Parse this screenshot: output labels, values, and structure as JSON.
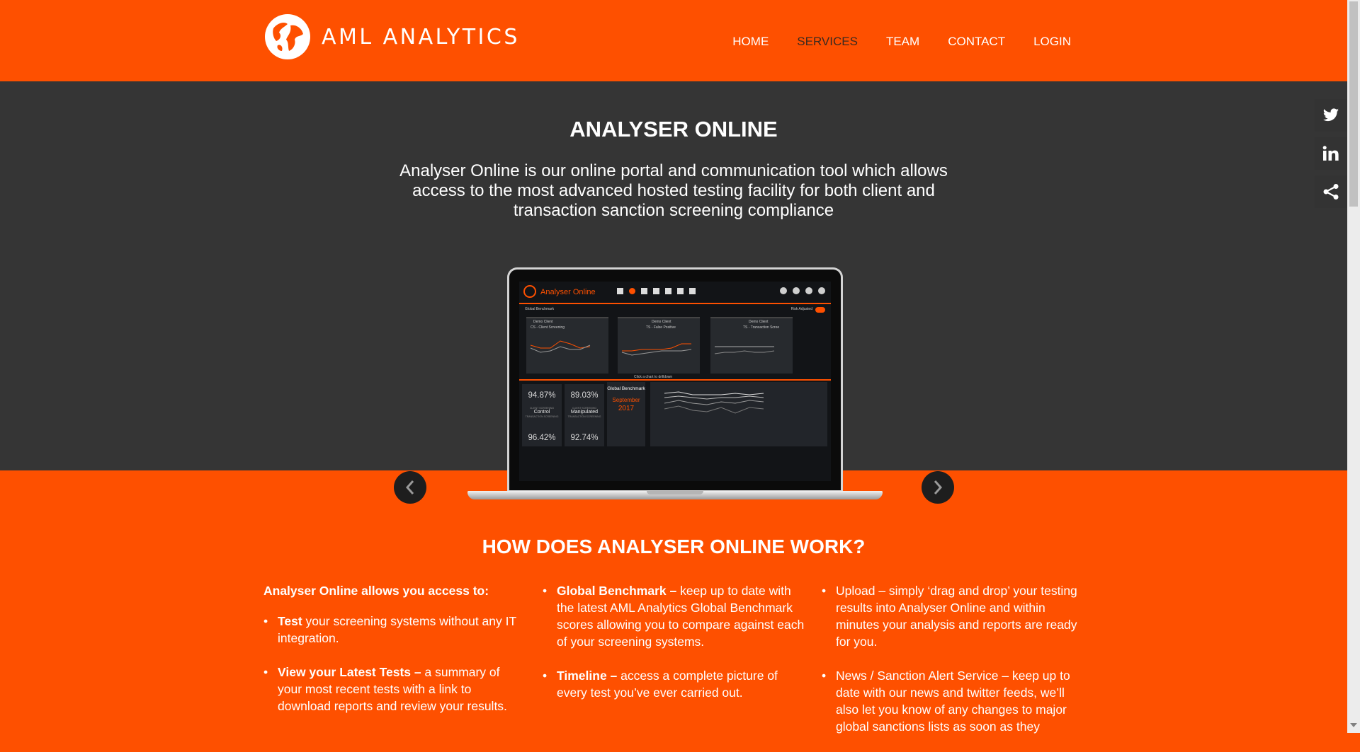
{
  "brand": {
    "name": "AML ANALYTICS",
    "accent": "#fe5000",
    "dark_band": "#353535"
  },
  "nav": {
    "items": [
      {
        "label": "HOME",
        "active": false
      },
      {
        "label": "SERVICES",
        "active": true
      },
      {
        "label": "TEAM",
        "active": false
      },
      {
        "label": "CONTACT",
        "active": false
      },
      {
        "label": "LOGIN",
        "active": false
      }
    ]
  },
  "hero": {
    "title": "ANALYSER ONLINE",
    "description": "Analyser Online is our online portal and communication tool which allows access to the most advanced hosted testing facility for both client and transaction sanction screening compliance",
    "prev_icon": "chevron-left-icon",
    "next_icon": "chevron-right-icon"
  },
  "dashboard": {
    "app_title": "Analyser Online",
    "global_benchmark_label": "Global Benchmark",
    "risk_adjusted_label": "Risk Adjusted",
    "click_chart_label": "Click a chart to drilldown",
    "chart_titles": [
      "Demo Client",
      "Demo Client",
      "Demo Client"
    ],
    "chart_subtitles": [
      "CS - Client Screening",
      "TS - False Positive",
      "TS - Transaction Scree"
    ],
    "stats": [
      {
        "pct": "94.87%",
        "tag": "CLIENT SCREENING",
        "label": "Control",
        "sub": "TRANSACTION SCREENING",
        "pct2": "96.42%"
      },
      {
        "pct": "89.03%",
        "tag": "CLIENT SCREENING",
        "label": "Manipulated",
        "sub": "TRANSACTION SCREENING",
        "pct2": "92.74%"
      }
    ],
    "benchmark": {
      "title": "Global Benchmark",
      "month": "September",
      "year": "2017"
    }
  },
  "how": {
    "title": "HOW DOES ANALYSER ONLINE WORK?",
    "intro": "Analyser Online allows you access to:",
    "col1": [
      {
        "bold": "Test",
        "text": " your screening systems without any IT integration."
      },
      {
        "bold": "View your Latest Tests –",
        "text": " a summary of your most recent tests with a link to download reports and review your results."
      }
    ],
    "col2": [
      {
        "bold": "Global Benchmark –",
        "text": " keep up to date with the latest AML Analytics Global Benchmark scores allowing you to compare against each of your screening systems."
      },
      {
        "bold": "Timeline –",
        "text": " access a complete picture of every test you’ve ever carried out."
      }
    ],
    "col3": [
      {
        "bold": "",
        "text": "Upload – simply ‘drag and drop’ your testing results into Analyser Online and within minutes your analysis and reports are ready for you."
      },
      {
        "bold": "",
        "text": "News / Sanction Alert Service – keep up to date with our news and twitter feeds, we’ll also let you know of any changes to major global sanctions lists as soon as they"
      }
    ]
  },
  "share": [
    {
      "icon": "twitter-icon"
    },
    {
      "icon": "linkedin-icon"
    },
    {
      "icon": "share-icon"
    }
  ]
}
